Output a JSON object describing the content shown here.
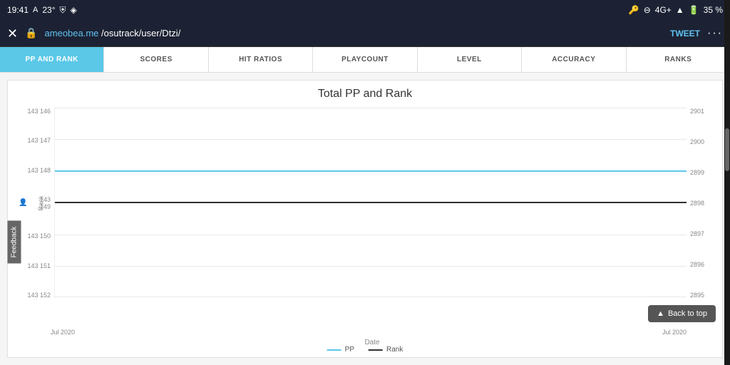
{
  "statusBar": {
    "time": "19:41",
    "battery": "35 %",
    "signal": "4G+"
  },
  "browserBar": {
    "url": "ameobea.me/osutrack/user/Dtzi/",
    "urlHighlight": "ameobea.me",
    "tweetLabel": "TWEET"
  },
  "tabs": [
    {
      "id": "pp-rank",
      "label": "PP AND RANK",
      "active": true
    },
    {
      "id": "scores",
      "label": "SCORES",
      "active": false
    },
    {
      "id": "hit-ratios",
      "label": "HIT RATIOS",
      "active": false
    },
    {
      "id": "playcount",
      "label": "PLAYCOUNT",
      "active": false
    },
    {
      "id": "level",
      "label": "LEVEL",
      "active": false
    },
    {
      "id": "accuracy",
      "label": "ACCURACY",
      "active": false
    },
    {
      "id": "ranks",
      "label": "RANKS",
      "active": false
    }
  ],
  "chart": {
    "title": "Total PP and Rank",
    "yAxisLeftValues": [
      "143 146",
      "143 147",
      "143 148",
      "143 149",
      "143 150",
      "143 151",
      "143 152"
    ],
    "yAxisRightValues": [
      "2901",
      "2900",
      "2899",
      "2898",
      "2897",
      "2896",
      "2895"
    ],
    "yAxisLabel": "Rank",
    "xAxisLabel": "Date",
    "xAxisValues": [
      "Jul 2020",
      "",
      "Jul 2020"
    ],
    "legend": {
      "ppLabel": "PP",
      "rankLabel": "Rank"
    }
  },
  "backToTop": "Back to top",
  "feedback": "Feedback"
}
